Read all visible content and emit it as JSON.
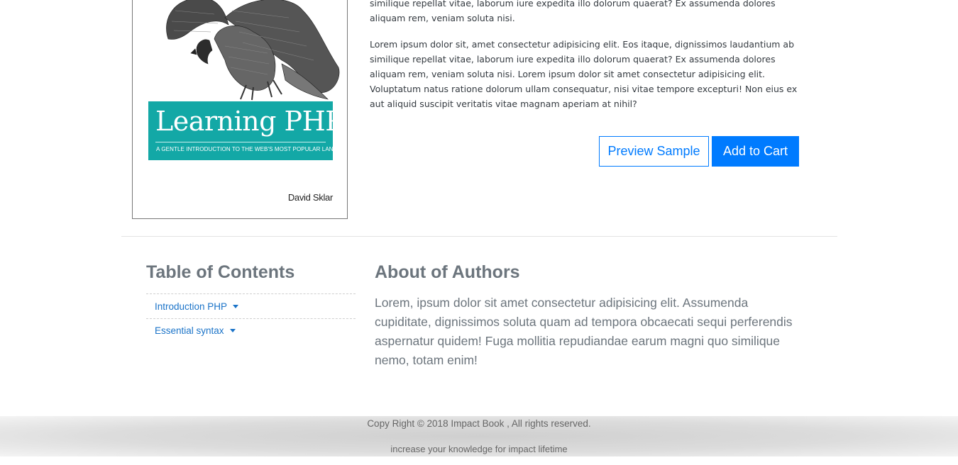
{
  "book": {
    "cover_title": "Learning PHP",
    "cover_subtitle": "A GENTLE INTRODUCTION TO THE WEB'S MOST POPULAR LANGUAGE",
    "cover_author": "David Sklar"
  },
  "description": {
    "paragraph1": "similique repellat vitae, laborum iure expedita illo dolorum quaerat? Ex assumenda dolores aliquam rem, veniam soluta nisi.",
    "paragraph2": "Lorem ipsum dolor sit, amet consectetur adipisicing elit. Eos itaque, dignissimos laudantium ab similique repellat vitae, laborum iure expedita illo dolorum quaerat? Ex assumenda dolores aliquam rem, veniam soluta nisi. Lorem ipsum dolor sit amet consectetur adipisicing elit. Voluptatum natus ratione dolorum ullam consequatur, nisi vitae tempore excepturi! Non eius ex aut aliquid suscipit veritatis vitae magnam aperiam at nihil?"
  },
  "actions": {
    "preview_label": "Preview Sample",
    "cart_label": "Add to Cart"
  },
  "toc": {
    "title": "Table of Contents",
    "items": [
      {
        "label": "Introduction PHP"
      },
      {
        "label": "Essential syntax"
      }
    ]
  },
  "about": {
    "title": "About of Authors",
    "text": "Lorem, ipsum dolor sit amet consectetur adipisicing elit. Assumenda cupiditate, dignissimos soluta quam ad tempora obcaecati sequi perferendis aspernatur quidem! Fuga mollitia repudiandae earum magni quo similique nemo, totam enim!"
  },
  "footer": {
    "copyright": "Copy Right © 2018 Impact Book , All rights reserved.",
    "tagline": "increase your knowledge for impact lifetime"
  },
  "colors": {
    "primary": "#007bff",
    "cover_band": "#13a8a6",
    "muted_heading": "#6c757d"
  }
}
